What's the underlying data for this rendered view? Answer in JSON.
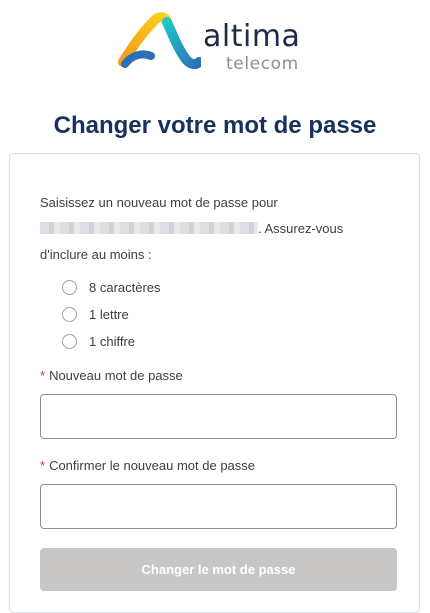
{
  "brand": {
    "name": "altima",
    "sub": "telecom",
    "colors": {
      "navy": "#1f2a44",
      "gray": "#8a8f96",
      "yellow": "#f7c21b",
      "teal": "#19b4c4",
      "blue": "#2b6fb5"
    }
  },
  "page": {
    "title": "Changer votre mot de passe"
  },
  "intro": {
    "line1": "Saisissez un nouveau mot de passe pour",
    "after_masked": ". Assurez-vous",
    "line3": "d'inclure au moins :"
  },
  "requirements": [
    {
      "label": "8 caractères"
    },
    {
      "label": "1 lettre"
    },
    {
      "label": "1 chiffre"
    }
  ],
  "fields": {
    "required_mark": "*",
    "new_password": {
      "label": "Nouveau mot de passe",
      "value": ""
    },
    "confirm_password": {
      "label": "Confirmer le nouveau mot de passe",
      "value": ""
    }
  },
  "submit": {
    "label": "Changer le mot de passe",
    "bg": "#c9c7c5"
  },
  "colors": {
    "required": "#c23934",
    "title": "#16325c",
    "border": "#d8dde6"
  }
}
